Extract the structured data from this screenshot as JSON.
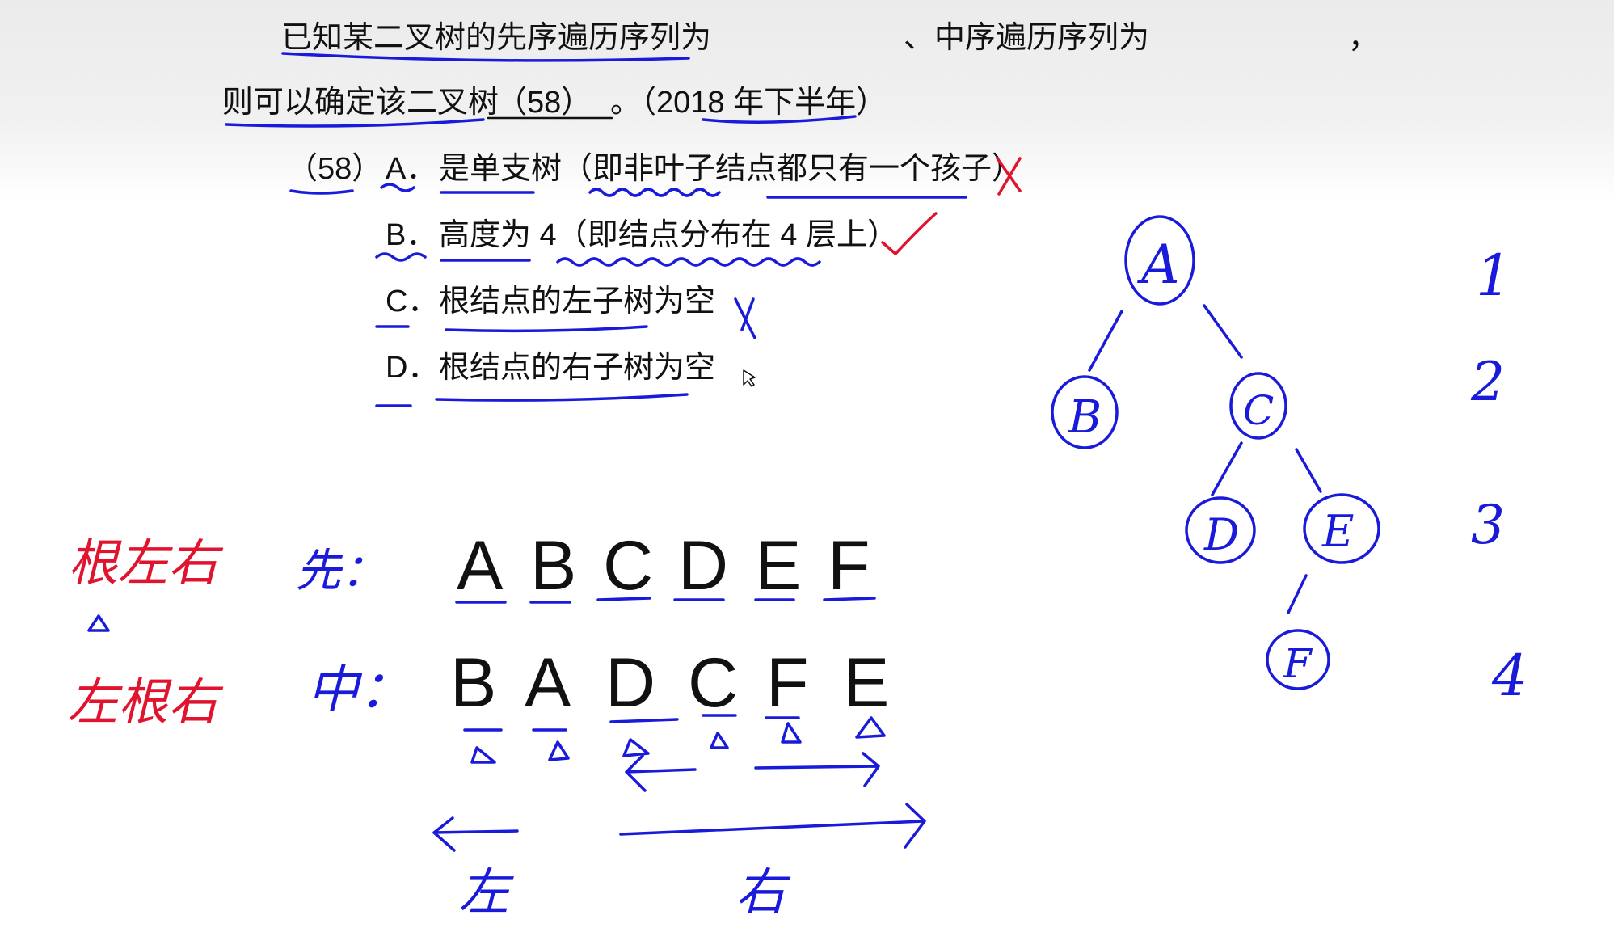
{
  "question": {
    "line1_a": "已知某二叉树的先序遍历序列为",
    "line1_b": "、中序遍历序列为",
    "line1_c": "，",
    "line2_a": "则可以确定该二叉树",
    "line2_blank": "（58）",
    "line2_b": "。（2018 年下半年）"
  },
  "options": {
    "number": "（58）",
    "items": [
      {
        "letter": "A．",
        "text": "是单支树（即非叶子结点都只有一个孩子）",
        "mark": "X"
      },
      {
        "letter": "B．",
        "text": "高度为 4（即结点分布在 4 层上）",
        "mark": "✓"
      },
      {
        "letter": "C．",
        "text": "根结点的左子树为空",
        "mark": "X"
      },
      {
        "letter": "D．",
        "text": "根结点的右子树为空",
        "mark": ""
      }
    ]
  },
  "sequences": {
    "pre_label": "先：",
    "pre": [
      "A",
      "B",
      "C",
      "D",
      "E",
      "F"
    ],
    "in_label": "中：",
    "in": [
      "B",
      "A",
      "D",
      "C",
      "F",
      "E"
    ]
  },
  "annotations": {
    "pre_rule": "根左右",
    "in_rule": "左根右",
    "left": "左",
    "right": "右"
  },
  "tree": {
    "nodes": [
      "A",
      "B",
      "C",
      "D",
      "E",
      "F"
    ],
    "levels": [
      "1",
      "2",
      "3",
      "4"
    ]
  },
  "colors": {
    "blue_ink": "#1a1adb",
    "red_ink": "#e0142e",
    "text": "#111111"
  }
}
